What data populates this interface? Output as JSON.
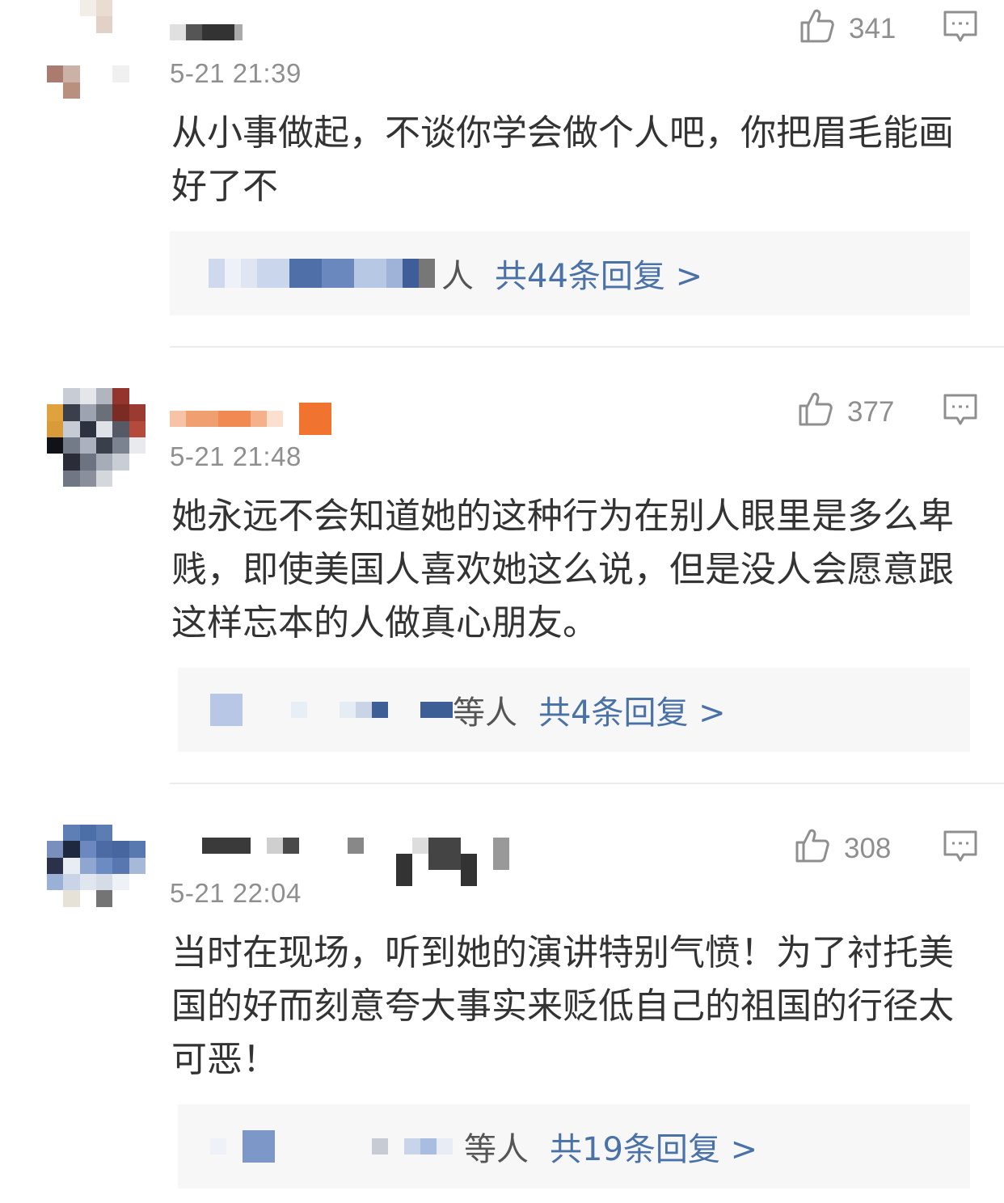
{
  "comments": [
    {
      "timestamp": "5-21 21:39",
      "likes": "341",
      "text": "从小事做起，不谈你学会做个人吧，你把眉毛能画好了不",
      "reply_suffix": "人",
      "reply_link": "共44条回复 >"
    },
    {
      "timestamp": "5-21 21:48",
      "likes": "377",
      "text": "她永远不会知道她的这种行为在别人眼里是多么卑贱，即使美国人喜欢她这么说，但是没人会愿意跟这样忘本的人做真心朋友。",
      "reply_suffix": "等人",
      "reply_link": "共4条回复 >"
    },
    {
      "timestamp": "5-21 22:04",
      "likes": "308",
      "text": "当时在现场，听到她的演讲特别气愤！为了衬托美国的好而刻意夸大事实来贬低自己的祖国的行径太可恶！",
      "reply_suffix": "等人",
      "reply_link": "共19条回复 >"
    }
  ],
  "icons": {
    "like": "thumbs-up-icon",
    "reply": "comment-icon"
  },
  "colors": {
    "text": "#333333",
    "meta": "#8f8f8f",
    "link": "#4a72a8",
    "reply_bg": "#f7f7f7"
  }
}
